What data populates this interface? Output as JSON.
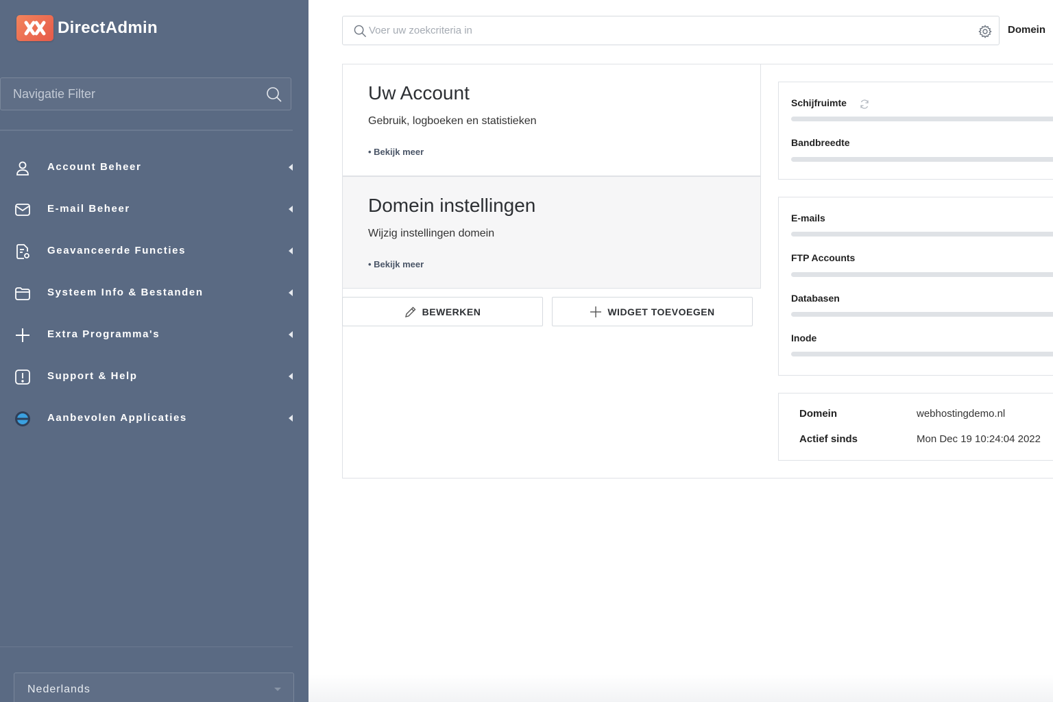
{
  "app": {
    "name": "DirectAdmin"
  },
  "sidebar": {
    "filter_placeholder": "Navigatie Filter",
    "items": [
      {
        "label": "Account Beheer",
        "icon": "user-icon"
      },
      {
        "label": "E-mail Beheer",
        "icon": "envelope-icon"
      },
      {
        "label": "Geavanceerde Functies",
        "icon": "advanced-settings-icon"
      },
      {
        "label": "Systeem Info & Bestanden",
        "icon": "folder-icon"
      },
      {
        "label": "Extra Programma's",
        "icon": "plus-icon"
      },
      {
        "label": "Support & Help",
        "icon": "alert-icon"
      },
      {
        "label": "Aanbevolen Applicaties",
        "icon": "apps-globe-icon"
      }
    ],
    "language": "Nederlands"
  },
  "header": {
    "search_placeholder": "Voer uw zoekcriteria in",
    "scope_label": "Domein"
  },
  "cards": [
    {
      "title": "Uw Account",
      "subtitle": "Gebruik, logboeken en statistieken",
      "link": "• Bekijk meer"
    },
    {
      "title": "Domein instellingen",
      "subtitle": "Wijzig instellingen domein",
      "link": "• Bekijk meer"
    }
  ],
  "actions": {
    "edit": "BEWERKEN",
    "add_widget": "WIDGET TOEVOEGEN"
  },
  "usage": {
    "resources": [
      {
        "label": "Schijfruimte",
        "percent": 0
      },
      {
        "label": "Bandbreedte",
        "percent": 0
      }
    ],
    "counts": [
      {
        "label": "E-mails",
        "percent": 0
      },
      {
        "label": "FTP Accounts",
        "percent": 0
      },
      {
        "label": "Databasen",
        "percent": 0
      },
      {
        "label": "Inode",
        "percent": 0
      }
    ]
  },
  "info": [
    {
      "key": "Domein",
      "value": "webhostingdemo.nl"
    },
    {
      "key": "Actief sinds",
      "value": "Mon Dec 19 10:24:04 2022"
    }
  ],
  "colors": {
    "sidebar_bg": "#5a6a83",
    "logo_accent": "#e8604f",
    "bar_track": "#dfe2e6"
  }
}
